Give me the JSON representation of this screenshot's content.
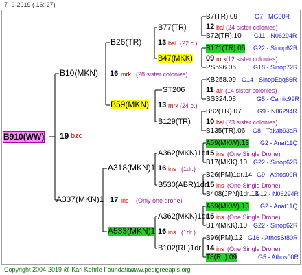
{
  "header": {
    "date": "7-  9-2019 ( 16: 27)"
  },
  "root": {
    "name": "B910(WW)",
    "gen": "19",
    "tag": "bzd"
  },
  "g1": [
    {
      "name": "B10(MKN)",
      "gen": "16",
      "tag": "mrk",
      "note": "(28 sister colonies)"
    },
    {
      "name": "A337(MKN)1",
      "gen": "17",
      "tag": "ins",
      "note": "(Only one drone)"
    }
  ],
  "g2": [
    {
      "name": "B26(TR)",
      "gen": "13",
      "tag": "bal",
      "note": "(22 c.)"
    },
    {
      "name": "B59(MKN)",
      "gen": "13",
      "tag": "mrk",
      "note": "(24 c.)"
    },
    {
      "name": "A318(MKN)1",
      "gen": "16",
      "tag": "ins",
      "note": "(1dr.)"
    },
    {
      "name": "A533(MKN)1",
      "gen": "16",
      "tag": "ins",
      "note": "(1dr.)"
    }
  ],
  "g3": [
    {
      "name": "B77(TR)",
      "gen": "12",
      "tag": "bal",
      "note": "(24 sister colonies)",
      "sire": "B7(TR).09",
      "sire_ref": "G7 - MG00R",
      "dam": "B72(TR).10",
      "dam_ref": "G11 - N06294R"
    },
    {
      "name": "B47(MKK)",
      "gen": "09",
      "tag": "mrk",
      "note": "(12 sister colonies)",
      "sire": "B171(TR).06",
      "sire_ref": "G22 - Sinop62R",
      "dam": "PS596.06",
      "dam_ref": "G18 - Sinop72R"
    },
    {
      "name": "ST206",
      "gen": "11",
      "tag": "alr",
      "note": "(14 sister colonies)",
      "sire": "KB258.09",
      "sire_ref": "G14 - SinopEgg86R",
      "dam": "SS324.08",
      "dam_ref": "G5 - Camic99R"
    },
    {
      "name": "B129(TR)",
      "gen": "10",
      "tag": "bal",
      "note": "(23 sister colonies)",
      "sire": "B82(TR).07",
      "sire_ref": "G9 - N06294R",
      "dam": "B135(TR).06",
      "dam_ref": "G8 - Takab93aR"
    },
    {
      "name": "A362(MKN)1dr",
      "gen": "15",
      "tag": "ins",
      "note": "(One Single Drone)",
      "sire": "A59(MKW).13",
      "sire_ref": "G2 - Anat11Q",
      "dam": "B17(MKK).10",
      "dam_ref": "G22 - Sinop62R"
    },
    {
      "name": "B530(ABR)1dr",
      "gen": "15",
      "tag": "ins",
      "note": "(One Single Drone)",
      "sire": "B26(PM)1dr.14",
      "sire_ref": "G9 - Athos00R",
      "dam": "B408(JPN)1dr.13",
      "dam_ref": "G12 - N06294R"
    },
    {
      "name": "A362(MKN)1dr",
      "gen": "15",
      "tag": "ins",
      "note": "(One Single Drone)",
      "sire": "A59(MKW).13",
      "sire_ref": "G2 - Anat11Q",
      "dam": "B17(MKK).10",
      "dam_ref": "G22 - Sinop62R"
    },
    {
      "name": "B102(RL)1dr",
      "gen": "14",
      "tag": "ins",
      "note": "(One Single Drone)",
      "sire": "B96(PM).12",
      "sire_ref": "G16 - AthosSt80R",
      "dam": "T8(RL).09",
      "dam_ref": "G5 - Athos00R"
    }
  ],
  "footer": {
    "copyright": "Copyright 2004-2019 @ Karl Kehrle Foundation",
    "site": "www.pedigreeapis.org"
  },
  "colors": {
    "root_highlight": "#ff88ff",
    "yellow_highlight": "#ffff00",
    "green_highlight": "#22d022",
    "tag_red": "#cc0000",
    "note_purple": "#9a1a9a",
    "ref_blue": "#1a1ad0"
  }
}
